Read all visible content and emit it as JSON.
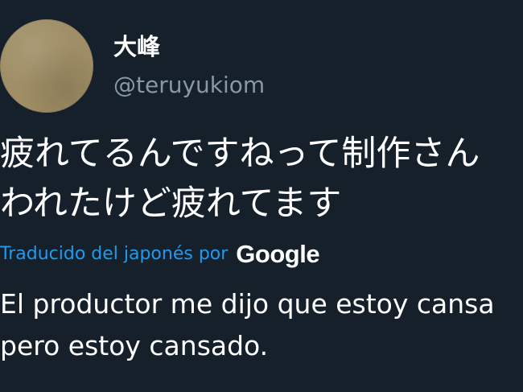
{
  "author": {
    "display_name": "大峰",
    "handle": "@teruyukiom",
    "avatar_icon": "user-avatar-icon"
  },
  "tweet": {
    "original_lines": [
      "疲れてるんですねって制作さん",
      "われたけど疲れてます"
    ],
    "translation_label": "Traducido del japonés por",
    "translation_provider": "Google",
    "translated_lines": [
      "El productor me dijo que estoy cansa",
      "pero estoy cansado."
    ]
  },
  "colors": {
    "background": "#15202b",
    "text": "#ffffff",
    "secondary_text": "#8899a6",
    "link": "#1d9bf0"
  }
}
